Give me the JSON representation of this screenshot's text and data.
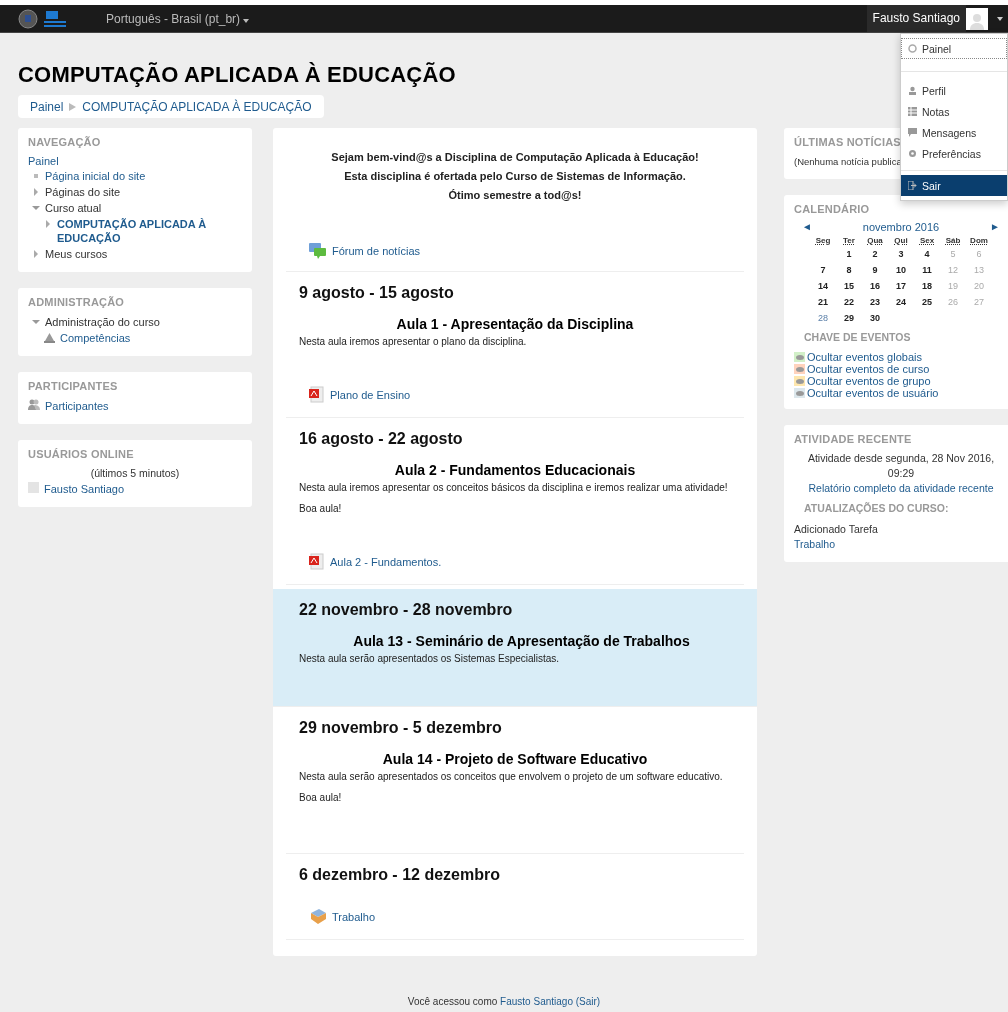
{
  "navbar": {
    "language": "Português - Brasil (pt_br)",
    "user_name": "Fausto Santiago"
  },
  "user_menu": {
    "groups": [
      [
        {
          "label": "Painel",
          "focused": true,
          "highlighted": false
        }
      ],
      [
        {
          "label": "Perfil",
          "focused": false,
          "highlighted": false
        },
        {
          "label": "Notas",
          "focused": false,
          "highlighted": false
        },
        {
          "label": "Mensagens",
          "focused": false,
          "highlighted": false
        },
        {
          "label": "Preferências",
          "focused": false,
          "highlighted": false
        }
      ],
      [
        {
          "label": "Sair",
          "focused": false,
          "highlighted": true
        }
      ]
    ]
  },
  "page_title": "COMPUTAÇÃO APLICADA À EDUCAÇÃO",
  "breadcrumb": [
    "Painel",
    "COMPUTAÇÃO APLICADA À EDUCAÇÃO"
  ],
  "navigation": {
    "title": "NAVEGAÇÃO",
    "root": "Painel",
    "items": [
      {
        "label": "Página inicial do site",
        "kind": "leaf"
      },
      {
        "label": "Páginas do site",
        "kind": "branch",
        "expanded": false
      },
      {
        "label": "Curso atual",
        "kind": "branch",
        "expanded": true,
        "children": [
          {
            "label": "COMPUTAÇÃO APLICADA À EDUCAÇÃO",
            "kind": "branch",
            "expanded": false,
            "bold": true
          }
        ]
      },
      {
        "label": "Meus cursos",
        "kind": "branch",
        "expanded": false
      }
    ]
  },
  "administration": {
    "title": "ADMINISTRAÇÃO",
    "items": [
      {
        "label": "Administração do curso",
        "kind": "branch",
        "expanded": true,
        "children": [
          {
            "label": "Competências",
            "kind": "link"
          }
        ]
      }
    ]
  },
  "participants": {
    "title": "PARTICIPANTES",
    "link": "Participantes"
  },
  "online_users": {
    "title": "USUÁRIOS ONLINE",
    "period": "(últimos 5 minutos)",
    "users": [
      "Fausto Santiago"
    ]
  },
  "intro": {
    "lines": [
      "Sejam bem-vind@s a Disciplina de Computação Aplicada à Educação!",
      "Esta disciplina é ofertada pelo Curso de Sistemas de Informação.",
      "Ótimo semestre a tod@s!"
    ],
    "activities": [
      {
        "kind": "forum",
        "label": "Fórum de notícias"
      }
    ]
  },
  "weeks": [
    {
      "title": "9 agosto - 15 agosto",
      "current": false,
      "summary_title": "Aula 1 - Apresentação da Disciplina",
      "paragraphs": [
        "Nesta aula iremos apresentar o plano da disciplina."
      ],
      "activities": [
        {
          "kind": "pdf",
          "label": "Plano de Ensino"
        }
      ]
    },
    {
      "title": "16 agosto - 22 agosto",
      "current": false,
      "summary_title": "Aula 2 - Fundamentos Educacionais",
      "paragraphs": [
        "Nesta aula iremos apresentar os conceitos básicos da disciplina e iremos realizar uma atividade!",
        "Boa aula!"
      ],
      "activities": [
        {
          "kind": "pdf",
          "label": "Aula 2 - Fundamentos."
        }
      ]
    },
    {
      "title": "22 novembro - 28 novembro",
      "current": true,
      "summary_title": "Aula 13 - Seminário de Apresentação de Trabalhos",
      "paragraphs": [
        "Nesta aula serão apresentados os Sistemas Especialistas."
      ]
    },
    {
      "title": "29 novembro - 5 dezembro",
      "current": false,
      "summary_title": "Aula 14 - Projeto de Software Educativo",
      "paragraphs": [
        "Nesta aula serão apresentados os conceitos que envolvem o projeto de um software educativo.",
        "Boa aula!"
      ]
    },
    {
      "title": "6 dezembro - 12 dezembro",
      "current": false,
      "activities": [
        {
          "kind": "assignment",
          "label": "Trabalho"
        }
      ]
    }
  ],
  "latest_news": {
    "title": "ÚLTIMAS NOTÍCIAS",
    "text": "(Nenhuma notícia publica"
  },
  "calendar": {
    "title": "CALENDÁRIO",
    "prev": "◄",
    "month": "novembro 2016",
    "next": "►",
    "weekdays": [
      "Seg",
      "Ter",
      "Qua",
      "Qui",
      "Sex",
      "Sáb",
      "Dom"
    ],
    "rows": [
      [
        {
          "kind": "empty"
        },
        {
          "day": "1",
          "weekend": false,
          "today": false
        },
        {
          "day": "2",
          "weekend": false,
          "today": false
        },
        {
          "day": "3",
          "weekend": false,
          "today": false
        },
        {
          "day": "4",
          "weekend": false,
          "today": false
        },
        {
          "day": "5",
          "weekend": true,
          "today": false
        },
        {
          "day": "6",
          "weekend": true,
          "today": false
        }
      ],
      [
        {
          "day": "7",
          "weekend": false,
          "today": false
        },
        {
          "day": "8",
          "weekend": false,
          "today": false
        },
        {
          "day": "9",
          "weekend": false,
          "today": false
        },
        {
          "day": "10",
          "weekend": false,
          "today": false
        },
        {
          "day": "11",
          "weekend": false,
          "today": false
        },
        {
          "day": "12",
          "weekend": true,
          "today": false
        },
        {
          "day": "13",
          "weekend": true,
          "today": false
        }
      ],
      [
        {
          "day": "14",
          "weekend": false,
          "today": false
        },
        {
          "day": "15",
          "weekend": false,
          "today": false
        },
        {
          "day": "16",
          "weekend": false,
          "today": false
        },
        {
          "day": "17",
          "weekend": false,
          "today": false
        },
        {
          "day": "18",
          "weekend": false,
          "today": false
        },
        {
          "day": "19",
          "weekend": true,
          "today": false
        },
        {
          "day": "20",
          "weekend": true,
          "today": false
        }
      ],
      [
        {
          "day": "21",
          "weekend": false,
          "today": false
        },
        {
          "day": "22",
          "weekend": false,
          "today": false
        },
        {
          "day": "23",
          "weekend": false,
          "today": false
        },
        {
          "day": "24",
          "weekend": false,
          "today": false
        },
        {
          "day": "25",
          "weekend": false,
          "today": false
        },
        {
          "day": "26",
          "weekend": true,
          "today": false
        },
        {
          "day": "27",
          "weekend": true,
          "today": false
        }
      ],
      [
        {
          "day": "28",
          "weekend": false,
          "today": true
        },
        {
          "day": "29",
          "weekend": false,
          "today": false
        },
        {
          "day": "30",
          "weekend": false,
          "today": false
        }
      ]
    ],
    "key_title": "CHAVE DE EVENTOS",
    "keys": [
      {
        "label": "Ocultar eventos globais",
        "color": "#d2f0c8"
      },
      {
        "label": "Ocultar eventos de curso",
        "color": "#ffd3bd"
      },
      {
        "label": "Ocultar eventos de grupo",
        "color": "#fee7ae"
      },
      {
        "label": "Ocultar eventos de usuário",
        "color": "#dce7ec"
      }
    ]
  },
  "recent_activity": {
    "title": "ATIVIDADE RECENTE",
    "since": "Atividade desde segunda, 28 Nov 2016, 09:29",
    "report_link": "Relatório completo da atividade recente",
    "updates_title": "ATUALIZAÇÕES DO CURSO:",
    "update_text": "Adicionado Tarefa",
    "update_link": "Trabalho"
  },
  "footer": {
    "prefix": "Você acessou como",
    "user": "Fausto Santiago",
    "logout": "(Sair)"
  }
}
